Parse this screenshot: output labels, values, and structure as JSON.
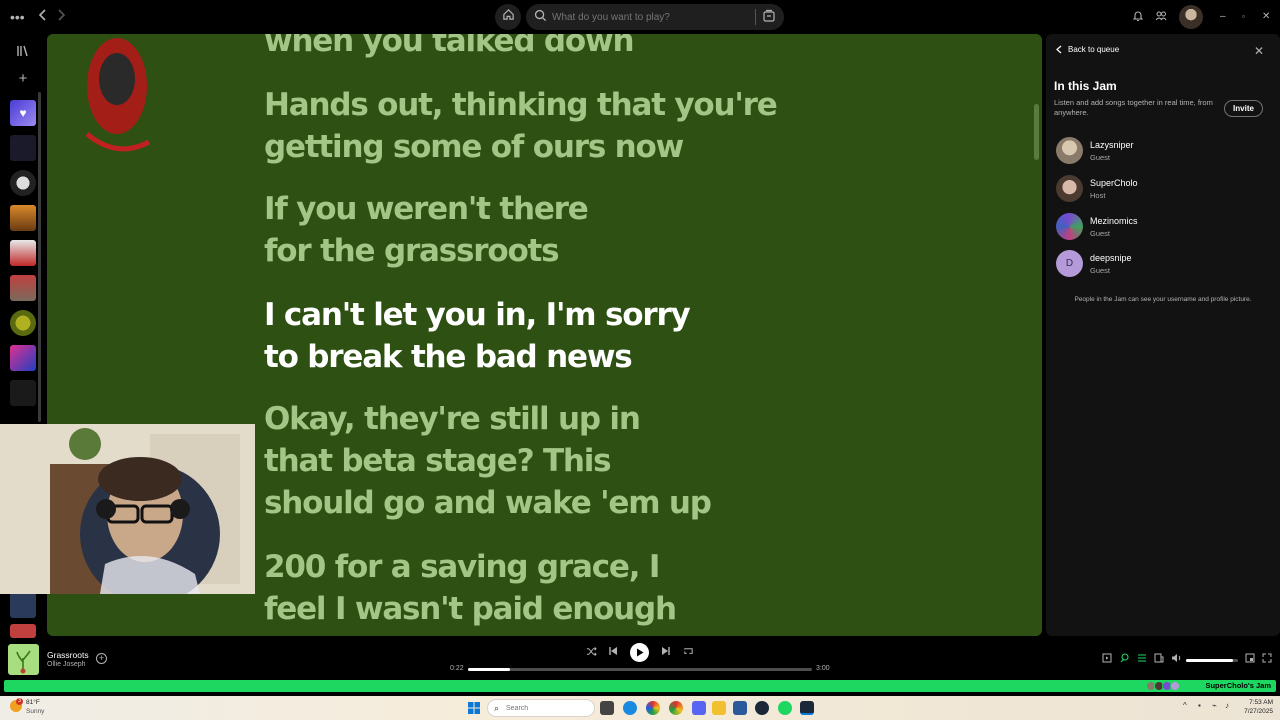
{
  "search": {
    "placeholder": "What do you want to play?"
  },
  "lyrics": [
    {
      "text": "when you talked down",
      "active": false
    },
    {
      "text": "Hands out, thinking that you're getting some of ours now",
      "active": false
    },
    {
      "text": "If you weren't there for the grassroots",
      "active": false
    },
    {
      "text": "I can't let you in, I'm sorry to break the bad news",
      "active": true
    },
    {
      "text": "Okay, they're still up in that beta stage? This should go and wake 'em up",
      "active": false
    },
    {
      "text": "200 for a saving grace, I feel I wasn't paid enough",
      "active": false
    }
  ],
  "lyric_lines": {
    "l0": [
      "when you talked down"
    ],
    "l1": [
      "Hands out, thinking that you're",
      "getting some of ours now"
    ],
    "l2": [
      "If you weren't there",
      "for the grassroots"
    ],
    "l3": [
      "I can't let you in, I'm sorry",
      "to break the bad news"
    ],
    "l4": [
      "Okay, they're still up in",
      "that beta stage? This",
      "should go and wake 'em up"
    ],
    "l5": [
      "200 for a saving grace, I",
      "feel I wasn't paid enough"
    ]
  },
  "jam_panel": {
    "back_label": "Back to queue",
    "title": "In this Jam",
    "subtitle": "Listen and add songs together in real time, from anywhere.",
    "invite_label": "Invite",
    "members": [
      {
        "name": "Lazysniper",
        "role": "Guest"
      },
      {
        "name": "SuperCholo",
        "role": "Host"
      },
      {
        "name": "Mezinomics",
        "role": "Guest"
      },
      {
        "name": "deepsnipe",
        "role": "Guest",
        "initial": "D"
      }
    ],
    "privacy_note": "People in the Jam can see your username and profile picture."
  },
  "now_playing": {
    "title": "Grassroots",
    "artist": "Ollie Joseph",
    "elapsed": "0:22",
    "duration": "3:00",
    "progress": 0.122,
    "volume": 0.9
  },
  "jam_bar": {
    "label": "SuperCholo's Jam"
  },
  "taskbar": {
    "weather_temp": "81°F",
    "weather_cond": "Sunny",
    "weather_badge": "3",
    "search_placeholder": "Search",
    "time": "7:53 AM",
    "date": "7/27/2025"
  },
  "colors": {
    "lyrics_bg": "#2e5012",
    "lyric_inactive": "#a3c585",
    "lyric_active": "#ffffff",
    "accent": "#1ed760"
  },
  "icons": [
    "more-icon",
    "back-arrow-icon",
    "forward-arrow-icon",
    "home-icon",
    "search-icon",
    "browse-icon",
    "bell-icon",
    "friends-icon",
    "shuffle-icon",
    "previous-icon",
    "play-icon",
    "next-icon",
    "repeat-icon",
    "volume-icon"
  ]
}
